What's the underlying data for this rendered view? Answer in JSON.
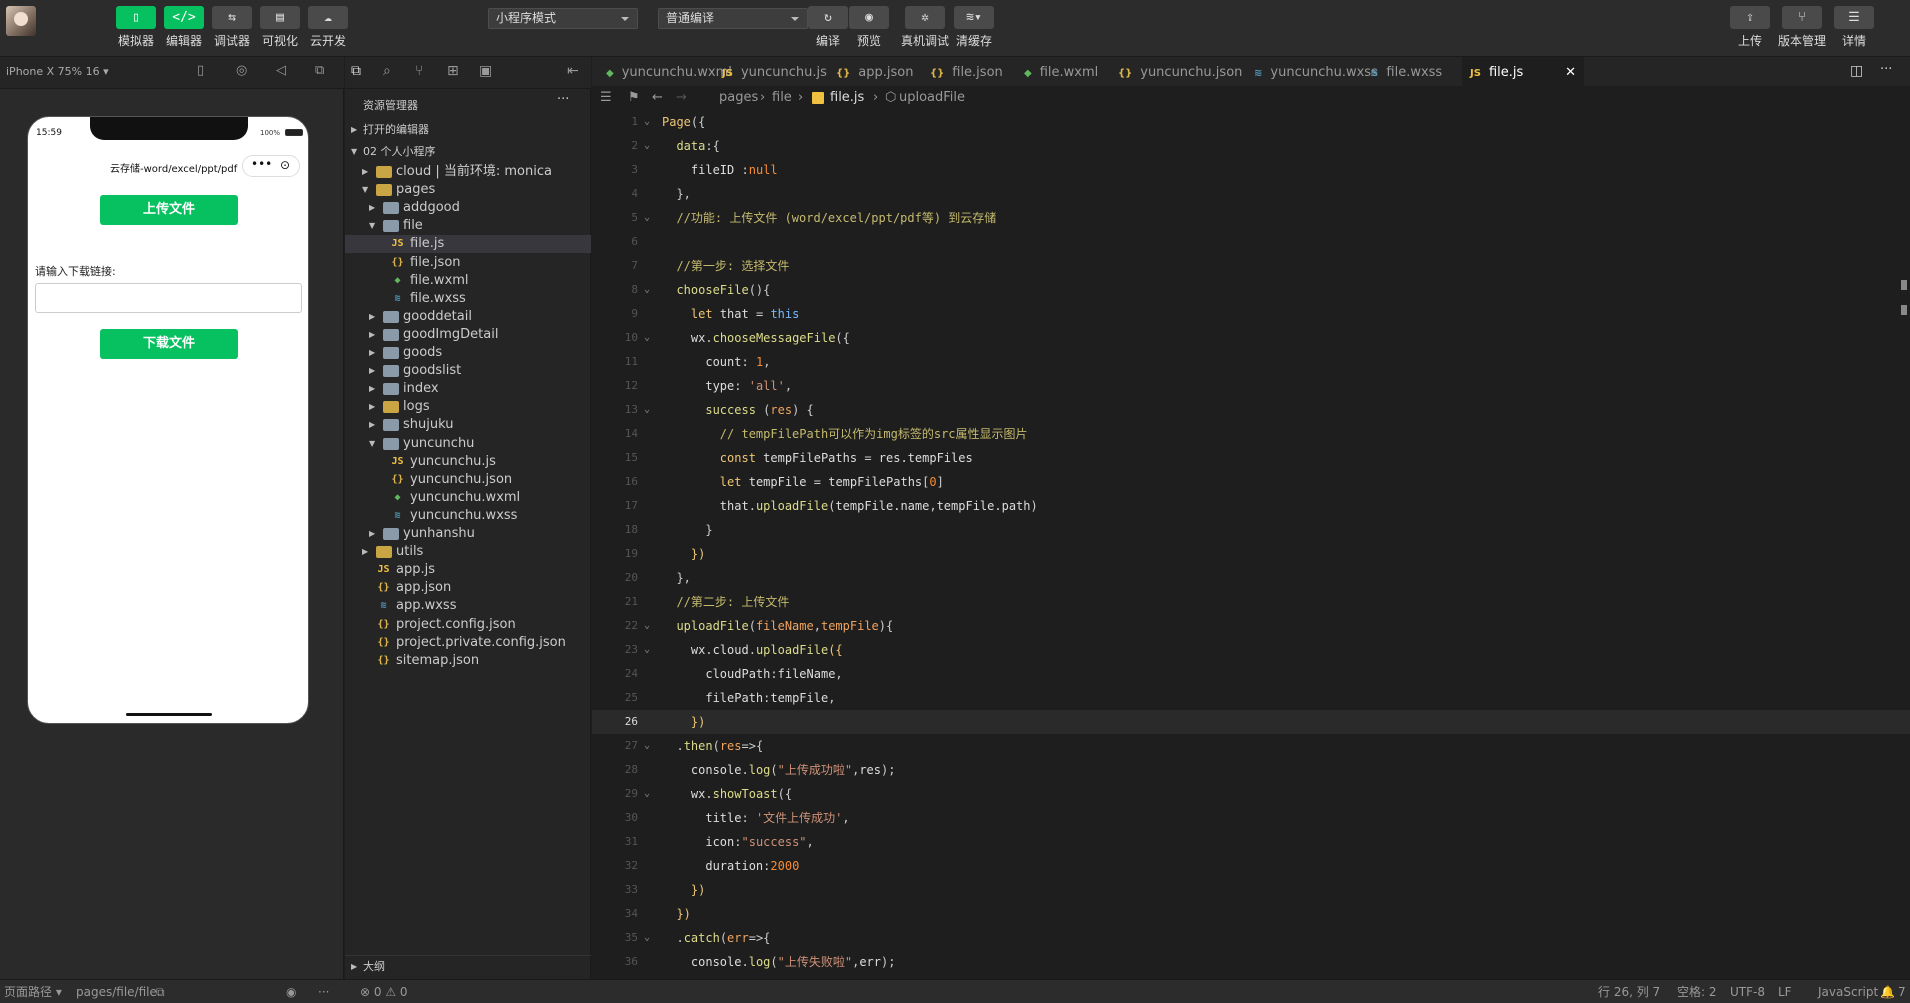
{
  "toolbar": {
    "simulator": "模拟器",
    "editor": "编辑器",
    "debugger": "调试器",
    "visual": "可视化",
    "cloud": "云开发",
    "mode": "小程序模式",
    "compile_mode": "普通编译",
    "compile": "编译",
    "preview": "预览",
    "real_debug": "真机调试",
    "clear_cache": "清缓存",
    "upload": "上传",
    "version": "版本管理",
    "details": "详情"
  },
  "device": {
    "label": "iPhone X 75% 16 ▾"
  },
  "phone": {
    "time": "15:59",
    "battery": "100%",
    "nav_title": "云存储-word/excel/ppt/pdf",
    "upload_btn": "上传文件",
    "input_label": "请输入下载链接:",
    "download_btn": "下载文件"
  },
  "explorer": {
    "title": "资源管理器",
    "open_editors": "打开的编辑器",
    "project": "02 个人小程序",
    "outline": "大纲",
    "items": [
      {
        "name": "cloud | 当前环境: monica",
        "type": "folder",
        "special": true,
        "depth": 1,
        "open": false
      },
      {
        "name": "pages",
        "type": "folder",
        "special": true,
        "depth": 1,
        "open": true
      },
      {
        "name": "addgood",
        "type": "folder",
        "depth": 2,
        "open": false
      },
      {
        "name": "file",
        "type": "folder",
        "depth": 2,
        "open": true
      },
      {
        "name": "file.js",
        "type": "js",
        "depth": 3,
        "active": true
      },
      {
        "name": "file.json",
        "type": "json",
        "depth": 3
      },
      {
        "name": "file.wxml",
        "type": "wxml",
        "depth": 3
      },
      {
        "name": "file.wxss",
        "type": "wxss",
        "depth": 3
      },
      {
        "name": "gooddetail",
        "type": "folder",
        "depth": 2,
        "open": false
      },
      {
        "name": "goodImgDetail",
        "type": "folder",
        "depth": 2,
        "open": false
      },
      {
        "name": "goods",
        "type": "folder",
        "depth": 2,
        "open": false
      },
      {
        "name": "goodslist",
        "type": "folder",
        "depth": 2,
        "open": false
      },
      {
        "name": "index",
        "type": "folder",
        "depth": 2,
        "open": false
      },
      {
        "name": "logs",
        "type": "folder",
        "special": true,
        "depth": 2,
        "open": false
      },
      {
        "name": "shujuku",
        "type": "folder",
        "depth": 2,
        "open": false
      },
      {
        "name": "yuncunchu",
        "type": "folder",
        "depth": 2,
        "open": true
      },
      {
        "name": "yuncunchu.js",
        "type": "js",
        "depth": 3
      },
      {
        "name": "yuncunchu.json",
        "type": "json",
        "depth": 3
      },
      {
        "name": "yuncunchu.wxml",
        "type": "wxml",
        "depth": 3
      },
      {
        "name": "yuncunchu.wxss",
        "type": "wxss",
        "depth": 3
      },
      {
        "name": "yunhanshu",
        "type": "folder",
        "depth": 2,
        "open": false
      },
      {
        "name": "utils",
        "type": "folder",
        "special": true,
        "depth": 1,
        "open": false
      },
      {
        "name": "app.js",
        "type": "js",
        "depth": 1
      },
      {
        "name": "app.json",
        "type": "json",
        "depth": 1
      },
      {
        "name": "app.wxss",
        "type": "wxss",
        "depth": 1
      },
      {
        "name": "project.config.json",
        "type": "json",
        "depth": 1
      },
      {
        "name": "project.private.config.json",
        "type": "json",
        "depth": 1
      },
      {
        "name": "sitemap.json",
        "type": "json",
        "depth": 1
      }
    ]
  },
  "tabs": [
    {
      "name": "yuncunchu.wxml",
      "type": "wxml"
    },
    {
      "name": "yuncunchu.js",
      "type": "js"
    },
    {
      "name": "app.json",
      "type": "json"
    },
    {
      "name": "file.json",
      "type": "json"
    },
    {
      "name": "file.wxml",
      "type": "wxml"
    },
    {
      "name": "yuncunchu.json",
      "type": "json"
    },
    {
      "name": "yuncunchu.wxss",
      "type": "wxss"
    },
    {
      "name": "file.wxss",
      "type": "wxss"
    },
    {
      "name": "file.js",
      "type": "js",
      "active": true
    }
  ],
  "breadcrumb": {
    "pages": "pages",
    "file": "file",
    "filejs": "file.js",
    "symbol": "uploadFile"
  },
  "code": [
    "<span class='kw'>Page</span><span class='pu'>({</span>",
    "  <span class='fn'>data</span><span class='pu'>:{</span>",
    "    <span class='pl'>fileID</span> <span class='pu'>:</span><span class='nm'>null</span>",
    "  <span class='pu'>},</span>",
    "  <span class='cm'>//功能: 上传文件 (word/excel/ppt/pdf等) 到云存储</span>",
    "",
    "  <span class='cm'>//第一步: 选择文件</span>",
    "  <span class='fn'>chooseFile</span><span class='pu'>(){</span>",
    "    <span class='kw'>let</span> <span class='pl'>that</span> <span class='pu'>=</span> <span class='bl'>this</span>",
    "    <span class='pl'>wx</span><span class='pu'>.</span><span class='fn'>chooseMessageFile</span><span class='pu'>({</span>",
    "      <span class='pl'>count</span><span class='pu'>:</span> <span class='nm'>1</span><span class='pu'>,</span>",
    "      <span class='pl'>type</span><span class='pu'>:</span> <span class='st'>'all'</span><span class='pu'>,</span>",
    "      <span class='fn'>success</span> <span class='pu'>(</span><span class='pa'>res</span><span class='pu'>) {</span>",
    "        <span class='cm'>// tempFilePath可以作为img标签的src属性显示图片</span>",
    "        <span class='kw'>const</span> <span class='pl'>tempFilePaths</span> <span class='pu'>=</span> <span class='pl'>res.tempFiles</span>",
    "        <span class='kw'>let</span> <span class='pl'>tempFile</span> <span class='pu'>=</span> <span class='pl'>tempFilePaths</span><span class='pu'>[</span><span class='nm'>0</span><span class='pu'>]</span>",
    "        <span class='pl'>that</span><span class='pu'>.</span><span class='fn'>uploadFile</span><span class='pu'>(</span><span class='pl'>tempFile.name</span><span class='pu'>,</span><span class='pl'>tempFile.path</span><span class='pu'>)</span>",
    "      <span class='pu'>}</span>",
    "    <span class='kw'>})</span>",
    "  <span class='pu'>},</span>",
    "  <span class='cm'>//第二步: 上传文件</span>",
    "  <span class='fn'>uploadFile</span><span class='pu'>(</span><span class='pa'>fileName</span><span class='pu'>,</span><span class='pa'>tempFile</span><span class='pu'>){</span>",
    "    <span class='pl'>wx</span><span class='pu'>.</span><span class='pl'>cloud</span><span class='pu'>.</span><span class='fn'>uploadFile</span><span class='kw'>({</span>",
    "      <span class='pl'>cloudPath</span><span class='pu'>:</span><span class='pl'>fileName</span><span class='pu'>,</span>",
    "      <span class='pl'>filePath</span><span class='pu'>:</span><span class='pl'>tempFile</span><span class='pu'>,</span>",
    "    <span class='kw'>})</span>",
    "  <span class='pu'>.</span><span class='fn'>then</span><span class='pu'>(</span><span class='pa'>res</span><span class='pu'>=>{</span>",
    "    <span class='pl'>console</span><span class='pu'>.</span><span class='fn'>log</span><span class='pu'>(</span><span class='st'>\"上传成功啦\"</span><span class='pu'>,</span><span class='pl'>res</span><span class='pu'>);</span>",
    "    <span class='pl'>wx</span><span class='pu'>.</span><span class='fn'>showToast</span><span class='pu'>({</span>",
    "      <span class='pl'>title</span><span class='pu'>:</span> <span class='st'>'文件上传成功'</span><span class='pu'>,</span>",
    "      <span class='pl'>icon</span><span class='pu'>:</span><span class='st'>\"success\"</span><span class='pu'>,</span>",
    "      <span class='pl'>duration</span><span class='pu'>:</span><span class='nm'>2000</span>",
    "    <span class='kw'>})</span>",
    "  <span class='kw'>})</span>",
    "  <span class='pu'>.</span><span class='fn'>catch</span><span class='pu'>(</span><span class='pa'>err</span><span class='pu'>=>{</span>",
    "    <span class='pl'>console</span><span class='pu'>.</span><span class='fn'>log</span><span class='pu'>(</span><span class='st'>\"上传失败啦\"</span><span class='pu'>,</span><span class='pl'>err</span><span class='pu'>);</span>"
  ],
  "fold_lines": [
    1,
    2,
    5,
    8,
    10,
    13,
    22,
    23,
    27,
    29,
    35
  ],
  "current_line": 26,
  "status": {
    "path_label": "页面路径 ▾",
    "path": "pages/file/file",
    "problems": "⊗ 0 ⚠ 0",
    "position": "行 26, 列 7",
    "spaces": "空格: 2",
    "encoding": "UTF-8",
    "eol": "LF",
    "language": "JavaScript",
    "notify_count": "7"
  },
  "colors": {
    "green": "#07c160",
    "js": "#f0c040",
    "json": "#e0b84a",
    "wxml": "#5fb85b",
    "wxss": "#519aba"
  }
}
